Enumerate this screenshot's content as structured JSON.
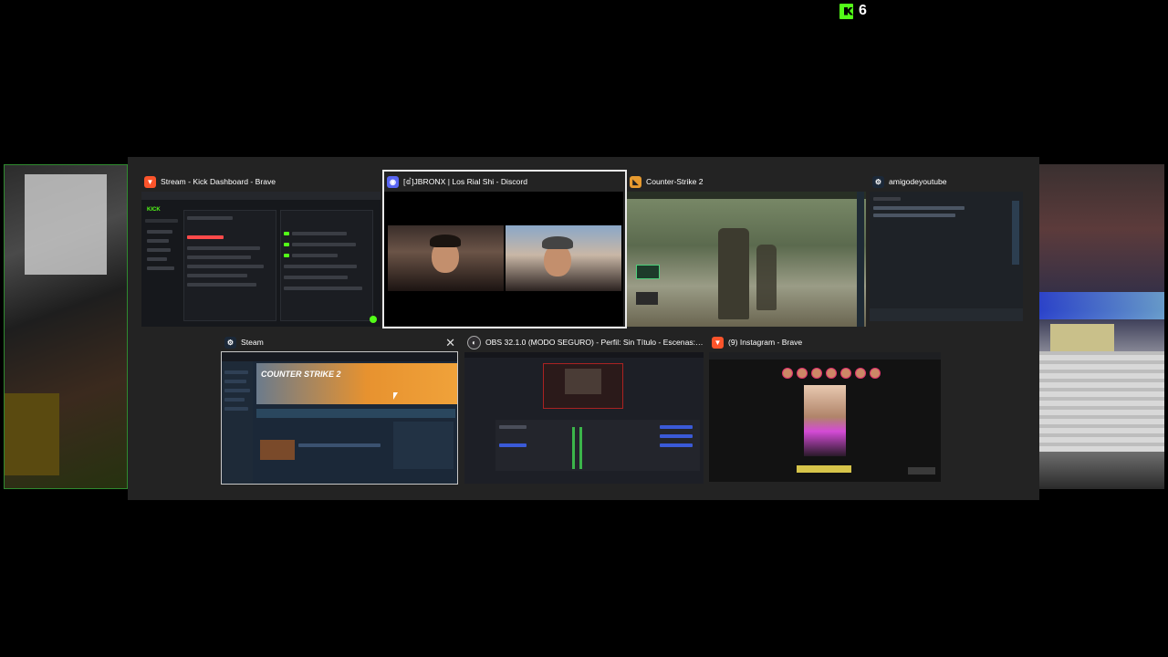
{
  "kick_badge": {
    "count": "6",
    "icon": "kick-logo-icon",
    "color": "#53fc18"
  },
  "windows": [
    {
      "title": "Stream - Kick Dashboard - Brave",
      "icon": "brave-icon",
      "app_color": "#fb542b"
    },
    {
      "title": "[ꀸ]JBRONX | Los Rial Shi - Discord",
      "icon": "discord-icon",
      "app_color": "#5865f2"
    },
    {
      "title": "Counter-Strike 2",
      "icon": "counter-strike-icon",
      "app_color": "#e79a2f"
    },
    {
      "title": "amigodeyoutube",
      "icon": "steam-icon",
      "app_color": "#1b2838"
    },
    {
      "title": "Steam",
      "icon": "steam-icon",
      "app_color": "#1b2838"
    },
    {
      "title": "OBS 32.1.0 (MODO SEGURO) - Perfil: Sin Título - Escenas: Sin...",
      "icon": "obs-icon",
      "app_color": "#302e31"
    },
    {
      "title": "(9) Instagram - Brave",
      "icon": "brave-icon",
      "app_color": "#fb542b"
    }
  ],
  "thumbnails": {
    "kick_logo_text": "KICK",
    "steam_banner_text": "COUNTER STRIKE 2"
  },
  "close_glyph": "✕"
}
